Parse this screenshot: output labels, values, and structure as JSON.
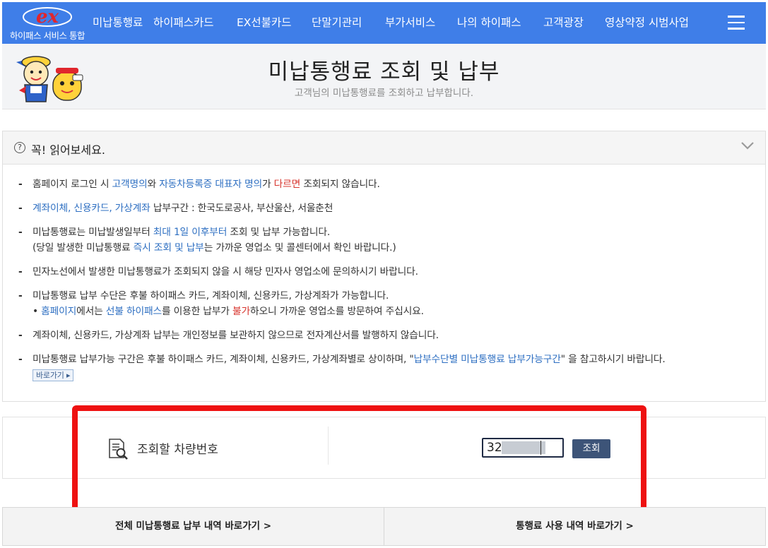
{
  "brand": {
    "logo_mark": "ex",
    "logo_text": "하이패스 서비스 통합",
    "accent": "#3f7ee8",
    "logo_red": "#e0262d"
  },
  "nav": {
    "items": [
      {
        "label": "미납통행료"
      },
      {
        "label": "하이패스카드"
      },
      {
        "label": "EX선불카드"
      },
      {
        "label": "단말기관리"
      },
      {
        "label": "부가서비스"
      },
      {
        "label": "나의 하이패스"
      },
      {
        "label": "고객광장"
      },
      {
        "label": "영상약정 시범사업"
      }
    ],
    "menu_icon": "hamburger-icon"
  },
  "header": {
    "title": "미납통행료 조회 및 납부",
    "subtitle": "고객님의 미납통행료를 조회하고 납부합니다."
  },
  "notice": {
    "title": "꼭! 읽어보세요.",
    "item1": {
      "a": "홈페이지 로그인 시 ",
      "b": "고객명의",
      "c": "와 ",
      "d": "자동차등록증 대표자 명의",
      "e": "가 ",
      "f": "다르면",
      "g": " 조회되지 않습니다."
    },
    "item2": {
      "a": "계좌이체, 신용카드, 가상계좌",
      "b": " 납부구간 : 한국도로공사, 부산울산, 서울춘천"
    },
    "item3": {
      "a": "미납통행료는 미납발생일부터 ",
      "b": "최대 1일 이후부터",
      "c": " 조회 및 납부 가능합니다.",
      "d": "(당일 발생한 미납통행료 ",
      "e": "즉시 조회 및 납부",
      "f": "는 가까운 영업소 및 콜센터에서 확인 바랍니다.)"
    },
    "item4": {
      "a": "민자노선에서 발생한 미납통행료가 조회되지 않을 시 해당 민자사 영업소에 문의하시기 바랍니다."
    },
    "item5": {
      "a": "미납통행료 납부 수단은 후불 하이패스 카드, 계좌이체, 신용카드, 가상계좌가 가능합니다.",
      "bullet": "• ",
      "b": "홈페이지",
      "c": "에서는 ",
      "d": "선불 하이패스",
      "e": "를 이용한 납부가 ",
      "f": "불가",
      "g": "하오니 가까운 영업소를 방문하여 주십시요."
    },
    "item6": {
      "a": "계좌이체, 신용카드, 가상계좌 납부는 개인정보를 보관하지 않으므로 전자계산서를 발행하지 않습니다."
    },
    "item7": {
      "a": "미납통행료 납부가능 구간은 후불 하이패스 카드, 계좌이체, 신용카드, 가상계좌별로 상이하며, \"",
      "b": "납부수단별 미납통행료 납부가능구간",
      "c": "\" 을 참고하시기 바랍니다.",
      "goto": "바로가기 ▸"
    }
  },
  "search": {
    "label": "조회할 차량번호",
    "input_value": "32",
    "button": "조회"
  },
  "bottom": {
    "left": "전체 미납통행료 납부 내역 바로가기 >",
    "right": "통행료 사용 내역 바로가기 >"
  }
}
